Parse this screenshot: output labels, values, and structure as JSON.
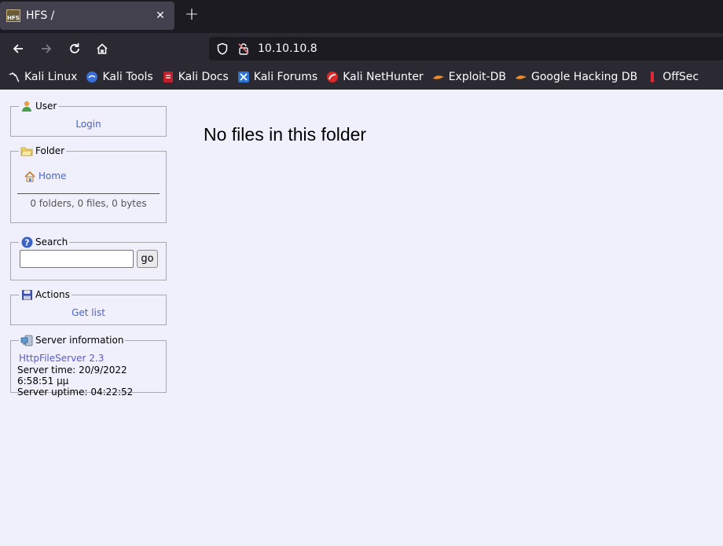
{
  "browser": {
    "tab_title": "HFS /",
    "tab_favicon_text": "HFS",
    "url": "10.10.10.8",
    "bookmarks": [
      {
        "label": "Kali Linux",
        "icon": "kali-dragon-icon"
      },
      {
        "label": "Kali Tools",
        "icon": "kali-tools-icon"
      },
      {
        "label": "Kali Docs",
        "icon": "kali-docs-icon"
      },
      {
        "label": "Kali Forums",
        "icon": "kali-forums-icon"
      },
      {
        "label": "Kali NetHunter",
        "icon": "kali-nethunter-icon"
      },
      {
        "label": "Exploit-DB",
        "icon": "exploit-db-icon"
      },
      {
        "label": "Google Hacking DB",
        "icon": "ghdb-icon"
      },
      {
        "label": "OffSec",
        "icon": "offsec-icon"
      }
    ]
  },
  "sidebar": {
    "user": {
      "legend": "User",
      "login": "Login"
    },
    "folder": {
      "legend": "Folder",
      "home": "Home",
      "stats": "0 folders, 0 files, 0 bytes"
    },
    "search": {
      "legend": "Search",
      "value": "",
      "go": "go"
    },
    "actions": {
      "legend": "Actions",
      "get_list": "Get list"
    },
    "server": {
      "legend": "Server information",
      "version_link": "HttpFileServer 2.3",
      "time": "Server time: 20/9/2022 6:58:51 μμ",
      "uptime": "Server uptime: 04:22:52"
    }
  },
  "main": {
    "message": "No files in this folder"
  }
}
